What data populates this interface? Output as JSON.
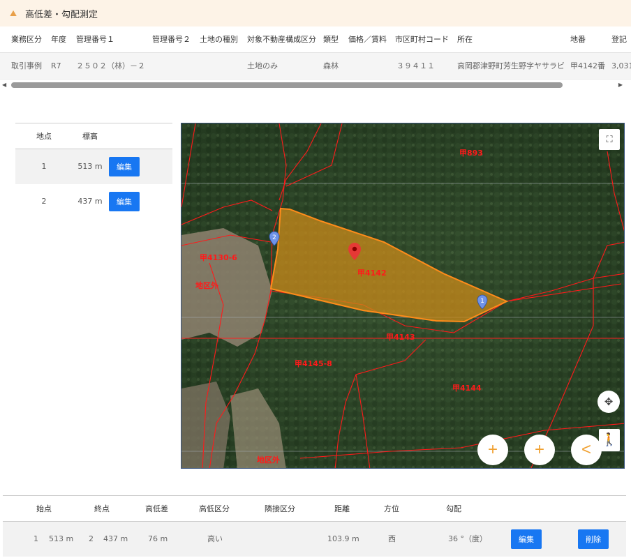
{
  "header": {
    "title": "高低差・勾配測定"
  },
  "top_table": {
    "headers": [
      "業務区分",
      "年度",
      "管理番号１",
      "管理番号２",
      "土地の種別",
      "対象不動産構成区分",
      "類型",
      "価格／賃料",
      "市区町村コード",
      "所在",
      "地番",
      "登記"
    ],
    "row": [
      "取引事例",
      "R7",
      "２５０２（林）－２",
      "",
      "",
      "土地のみ",
      "森林",
      "",
      "３９４１１",
      "高岡郡津野町芳生野字ヤサラビ",
      "甲4142番",
      "3,031"
    ]
  },
  "points": {
    "headers": [
      "地点",
      "標高"
    ],
    "rows": [
      {
        "point": "1",
        "elevation": "513 m",
        "edit": "編集"
      },
      {
        "point": "2",
        "elevation": "437 m",
        "edit": "編集"
      }
    ]
  },
  "map": {
    "labels": [
      "甲893",
      "甲4142",
      "甲4143",
      "甲4145-8",
      "甲4144",
      "甲4130-6",
      "地区外",
      "地区外"
    ],
    "markers": [
      "1",
      "2"
    ],
    "fullscreen_icon": "fullscreen-icon",
    "location_icon": "move-icon",
    "pegman_icon": "pegman-icon",
    "buttons": [
      "+",
      "+",
      "<"
    ]
  },
  "results": {
    "headers": [
      "始点",
      "終点",
      "高低差",
      "高低区分",
      "隣接区分",
      "距離",
      "方位",
      "勾配"
    ],
    "row": {
      "start_point": "1",
      "start_elev": "513 m",
      "end_point": "2",
      "end_elev": "437 m",
      "diff": "76 m",
      "level": "高い",
      "adjacent": "",
      "distance": "103.9 m",
      "direction": "西",
      "slope": "36 °（度）",
      "edit": "編集",
      "delete": "削除"
    }
  },
  "colors": {
    "accent": "#1877f2",
    "header_bg": "#fdf3e7",
    "parcel_fill": "#c98a1a",
    "lines": "#ff1a1a"
  }
}
